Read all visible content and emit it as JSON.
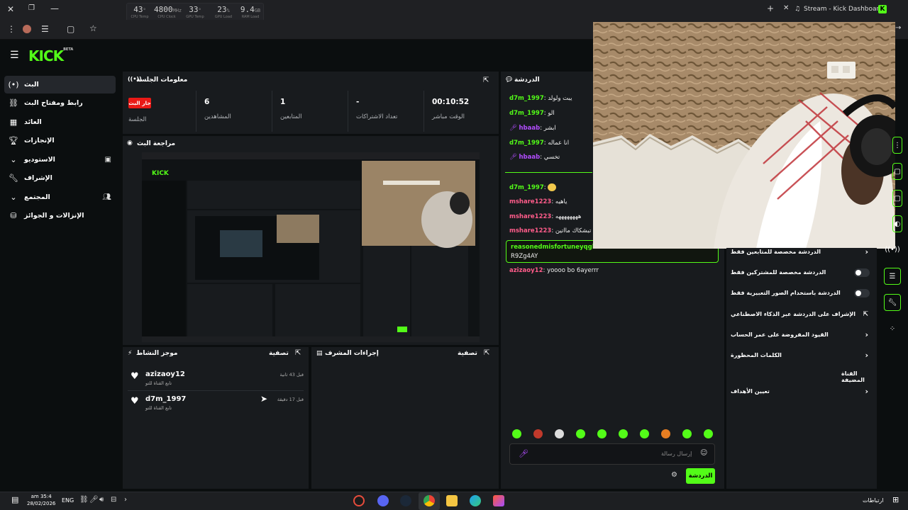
{
  "browser": {
    "tab_title": "Stream - Kick Dashboard",
    "hw_monitor": [
      {
        "value": "43",
        "unit": "°",
        "label": "CPU Temp"
      },
      {
        "value": "4800",
        "unit": "MHz",
        "label": "CPU Clock"
      },
      {
        "value": "33",
        "unit": "°",
        "label": "GPU Temp"
      },
      {
        "value": "23",
        "unit": "%",
        "label": "GPU Load"
      },
      {
        "value": "9.4",
        "unit": "GB",
        "label": "RAM Load"
      }
    ]
  },
  "logo": {
    "text": "KICK",
    "badge": "BETA"
  },
  "sidebar": {
    "items": [
      {
        "label": "البث",
        "icon": "broadcast-icon",
        "active": true
      },
      {
        "label": "رابط ومفتاح البث",
        "icon": "link-icon"
      },
      {
        "label": "العائد",
        "icon": "revenue-icon"
      },
      {
        "label": "الإنجازات",
        "icon": "trophy-icon"
      },
      {
        "label": "الاستوديو",
        "icon": "studio-icon",
        "chevron": "v"
      },
      {
        "label": "الإشراف",
        "icon": "wrench-icon"
      },
      {
        "label": "المجتمع",
        "icon": "community-icon",
        "chevron": "v"
      },
      {
        "label": "الإنزالات و الجوائز",
        "icon": "drops-icon"
      }
    ]
  },
  "session_info": {
    "title": "معلومات الجلسة",
    "badge": "جار البث",
    "badge_label": "الجلسة",
    "stats": [
      {
        "value": "6",
        "label": "المشاهدين"
      },
      {
        "value": "1",
        "label": "المتابعين"
      },
      {
        "value": "-",
        "label": "تعداد الاشتراكات"
      },
      {
        "value": "00:10:52",
        "label": "الوقت مباشر"
      }
    ]
  },
  "preview": {
    "title": "مراجعة البث"
  },
  "activity": {
    "title": "موجز النشاط",
    "filter": "تصفية",
    "items": [
      {
        "user": "azizaoy12",
        "sub": "تابع القناة للتو",
        "time": "قبل 43 ثانية"
      },
      {
        "user": "d7m_1997",
        "sub": "تابع القناة للتو",
        "time": "قبل 17 دقيقة"
      }
    ]
  },
  "mod_actions": {
    "title": "إجراءات المشرف",
    "filter": "تصفية"
  },
  "chat": {
    "title": "الدردشة",
    "messages": [
      {
        "user": "d7m_1997",
        "text": "يبت ولولد",
        "color": "green"
      },
      {
        "user": "d7m_1997",
        "text": "الو",
        "color": "green"
      },
      {
        "user": "hbaab",
        "text": "ابشر",
        "color": "purple"
      },
      {
        "user": "d7m_1997",
        "text": "انا عماله",
        "color": "green"
      },
      {
        "user": "hbaab",
        "text": "تخسي",
        "color": "purple"
      },
      {
        "user": "d7m_1997",
        "text": "",
        "color": "green"
      },
      {
        "user": "mshare1223",
        "text": "ياهيه",
        "color": "red"
      },
      {
        "user": "mshare1223",
        "text": "ههههههههه",
        "color": "red"
      },
      {
        "user": "mshare1223",
        "text": "الدعم تبشكاك مااتين",
        "color": "red"
      }
    ],
    "pinned_user": "reasonedmisfortuneyqgb:",
    "pinned_text": "R9Zg4AY",
    "last_user": "azizaoy12",
    "last_text": "yoooo bo 6ayerrr",
    "input_placeholder": "إرسال رسالة",
    "send_label": "الدردشة"
  },
  "settings": {
    "rows": [
      {
        "label": "الدردشة مخصصة للمتابعين فقط",
        "type": "chevron"
      },
      {
        "label": "الدردشة مخصصة للمشتركين فقط",
        "type": "toggle"
      },
      {
        "label": "الدردشة باستخدام الصور التعبيرية فقط",
        "type": "toggle"
      },
      {
        "label": "الإشراف على الدردشة عبر الذكاء الاصطناعي",
        "type": "external"
      },
      {
        "label": "القيود المفروضة على عمر الحساب",
        "type": "chevron"
      },
      {
        "label": "الكلمات المحظورة",
        "type": "chevron"
      },
      {
        "label": "القناة المضيفة",
        "type": "none"
      },
      {
        "label": "تعيين الأهداف",
        "type": "chevron"
      }
    ]
  },
  "taskbar": {
    "time": "am 35:4",
    "date": "28/02/2026",
    "lang": "ENG",
    "notify": "ارتباطات"
  },
  "colors": {
    "accent": "#53fc18",
    "live": "#e91916",
    "bg": "#0b0e0f",
    "panel": "#181b1e"
  }
}
